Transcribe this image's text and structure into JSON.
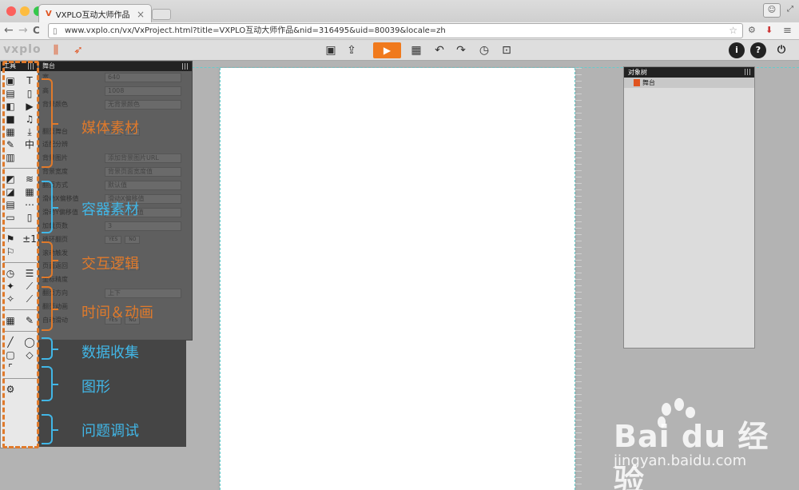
{
  "browser": {
    "tab_title": "VXPLO互动大师作品",
    "tab_icon_text": "V",
    "close_glyph": "×",
    "url": "www.vxplo.cn/vx/VxProject.html?title=VXPLO互动大师作品&nid=316495&uid=80039&locale=zh",
    "back_glyph": "←",
    "forward_glyph": "→",
    "reload_glyph": "C",
    "menu_glyph": "≡",
    "star_glyph": "☆"
  },
  "app": {
    "logo": "vxplo",
    "play_glyph": "▶",
    "info_glyph": "i",
    "help_glyph": "?",
    "power_glyph": "⏻"
  },
  "tools": {
    "title": "工具"
  },
  "stage": {
    "title": "舞台",
    "rows": [
      {
        "label": "宽",
        "value": "640"
      },
      {
        "label": "高",
        "value": "1008"
      },
      {
        "label": "背景颜色",
        "value": "无背景颜色"
      },
      {
        "label": "",
        "value": ""
      },
      {
        "label": "翻页舞台",
        "yes": "YES",
        "no": "NO"
      },
      {
        "label": "适配分辨",
        "value": ""
      },
      {
        "label": "背景图片",
        "value": "添加背景图片URL"
      },
      {
        "label": "背景宽度",
        "value": "背景页面宽度值"
      },
      {
        "label": "翻页方式",
        "value": "默认值"
      },
      {
        "label": "滑动X偏移值",
        "value": "滑动X偏移值"
      },
      {
        "label": "滑动Y偏移值",
        "value": "滑动Y偏移值"
      },
      {
        "label": "加载页数",
        "value": "3"
      },
      {
        "label": "循环翻页",
        "yes": "YES",
        "no": "NO"
      },
      {
        "label": "滚动触发",
        "value": ""
      },
      {
        "label": "页面返回",
        "yes": "YES",
        "no": "NO"
      },
      {
        "label": "坐标精度",
        "value": ""
      },
      {
        "label": "翻页方向",
        "value": "上下"
      },
      {
        "label": "翻页动画",
        "value": ""
      },
      {
        "label": "自动滑动",
        "yes": "YES",
        "no": "NO"
      }
    ]
  },
  "categories": {
    "media": "媒体素材",
    "container": "容器素材",
    "logic": "交互逻辑",
    "time": "时间＆动画",
    "data": "数据收集",
    "shape": "图形",
    "debug": "问题调试"
  },
  "object_tree": {
    "title": "对象树",
    "item": "舞台"
  },
  "watermark": {
    "brand": "Bai  du 经验",
    "url": "jingyan.baidu.com"
  },
  "colors": {
    "accent_orange": "#e07a2b",
    "accent_blue": "#41b6e6",
    "play": "#f07a1d"
  }
}
